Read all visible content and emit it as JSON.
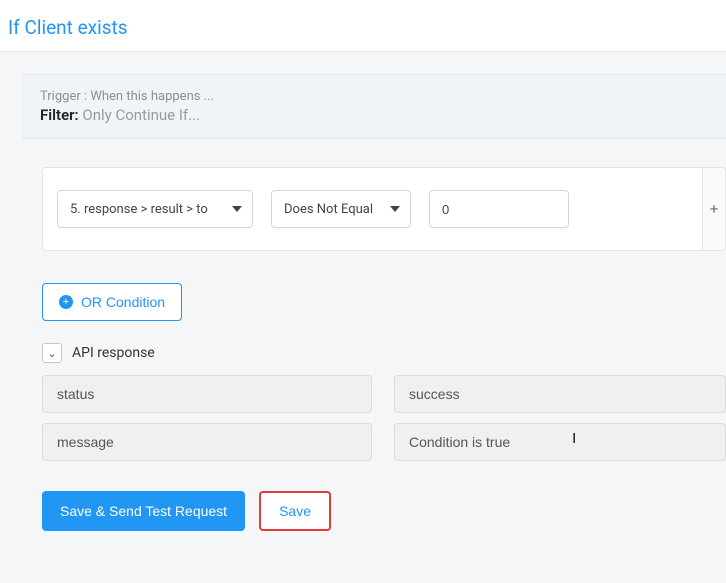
{
  "title": "If Client exists",
  "trigger": {
    "line1": "Trigger : When this happens ...",
    "filter_label": "Filter:",
    "filter_desc": "Only Continue If..."
  },
  "condition": {
    "field": "5. response > result > to",
    "operator": "Does Not Equal",
    "value": "0"
  },
  "buttons": {
    "or_condition": "OR Condition",
    "add": "+"
  },
  "api_response": {
    "label": "API response",
    "rows": [
      {
        "key": "status",
        "value": "success"
      },
      {
        "key": "message",
        "value": "Condition is true"
      }
    ]
  },
  "actions": {
    "save_send": "Save & Send Test Request",
    "save": "Save"
  }
}
